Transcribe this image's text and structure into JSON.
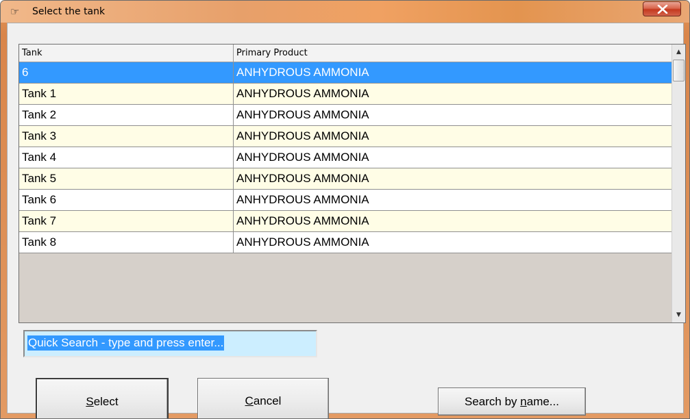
{
  "window": {
    "title": "Select the tank",
    "title_icon": "pointing-hand-icon",
    "close_icon": "close-icon"
  },
  "grid": {
    "columns": [
      "Tank",
      "Primary Product"
    ],
    "rows": [
      {
        "tank": "6",
        "product": "ANHYDROUS AMMONIA",
        "selected": true
      },
      {
        "tank": "Tank 1",
        "product": "ANHYDROUS AMMONIA"
      },
      {
        "tank": "Tank 2",
        "product": "ANHYDROUS AMMONIA"
      },
      {
        "tank": "Tank 3",
        "product": "ANHYDROUS AMMONIA"
      },
      {
        "tank": "Tank 4",
        "product": "ANHYDROUS AMMONIA"
      },
      {
        "tank": "Tank 5",
        "product": "ANHYDROUS AMMONIA"
      },
      {
        "tank": "Tank 6",
        "product": "ANHYDROUS AMMONIA"
      },
      {
        "tank": "Tank 7",
        "product": "ANHYDROUS AMMONIA"
      },
      {
        "tank": "Tank 8",
        "product": "ANHYDROUS AMMONIA"
      }
    ],
    "row_colors": {
      "selected": "#3399ff",
      "alt": "#fffde6",
      "normal": "#ffffff"
    }
  },
  "search": {
    "value": "Quick Search - type and press enter..."
  },
  "buttons": {
    "select": {
      "pre": "",
      "accel": "S",
      "post": "elect"
    },
    "cancel": {
      "pre": "",
      "accel": "C",
      "post": "ancel"
    },
    "search_by_name": {
      "pre": "Search by ",
      "accel": "n",
      "post": "ame..."
    }
  }
}
